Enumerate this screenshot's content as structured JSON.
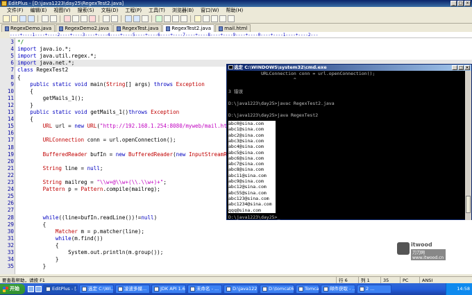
{
  "window": {
    "title": "EditPlus - [D:\\java1223\\day25\\RegexTest2.java]"
  },
  "menu": [
    "文件(F)",
    "编辑(E)",
    "视图(V)",
    "搜索(S)",
    "文档(D)",
    "工程(P)",
    "工具(T)",
    "浏览器(B)",
    "窗口(W)",
    "帮助(H)"
  ],
  "tabs": [
    {
      "label": "RegexDemo.java"
    },
    {
      "label": "RegexDemo2.java"
    },
    {
      "label": "RegexTest.java"
    },
    {
      "label": "RegexTest2.java"
    },
    {
      "label": "mail.html"
    }
  ],
  "ruler": "----+----1----+----2----+----3----+----4----+----5----+----6----+----7----+----8----+----9----+----0----+----1----+----2---",
  "editor": {
    "lines": [
      {
        "n": "3",
        "t": "*/",
        "cls": "cmt"
      },
      {
        "n": "4",
        "t": "import java.io.*;",
        "cls": "imp"
      },
      {
        "n": "5",
        "t": "import java.util.regex.*;",
        "cls": "imp"
      },
      {
        "n": "6",
        "t": "import java.net.*;",
        "cls": "imp"
      },
      {
        "n": "7",
        "t": "class RegexTest2",
        "cls": "cls"
      },
      {
        "n": "8",
        "t": "{",
        "cls": ""
      },
      {
        "n": "9",
        "t": "    public static void main(String[] args) throws Exception",
        "cls": "main"
      },
      {
        "n": "10",
        "t": "    {",
        "cls": ""
      },
      {
        "n": "11",
        "t": "        getMails_1();",
        "cls": ""
      },
      {
        "n": "12",
        "t": "    }",
        "cls": ""
      },
      {
        "n": "13",
        "t": "    public static void getMails_1()throws Exception",
        "cls": "m2"
      },
      {
        "n": "14",
        "t": "    {",
        "cls": ""
      },
      {
        "n": "15",
        "t": "        URL url = new URL(\"http://192.168.1.254:8080/myweb/mail.html\");",
        "cls": "url"
      },
      {
        "n": "16",
        "t": "",
        "cls": ""
      },
      {
        "n": "17",
        "t": "        URLConnection conn = url.openConnection();",
        "cls": "conn"
      },
      {
        "n": "18",
        "t": "",
        "cls": ""
      },
      {
        "n": "19",
        "t": "        BufferedReader bufIn = new BufferedReader(new InputStreamReader(conn.getInputStream()));",
        "cls": "buf"
      },
      {
        "n": "20",
        "t": "",
        "cls": ""
      },
      {
        "n": "21",
        "t": "        String line = null;",
        "cls": "str1"
      },
      {
        "n": "22",
        "t": "",
        "cls": ""
      },
      {
        "n": "23",
        "t": "        String mailreg = \"\\\\w+@\\\\w+(\\\\.\\\\w+)+\";",
        "cls": "reg"
      },
      {
        "n": "24",
        "t": "        Pattern p = Pattern.compile(mailreg);",
        "cls": "pat"
      },
      {
        "n": "25",
        "t": "",
        "cls": ""
      },
      {
        "n": "26",
        "t": "",
        "cls": ""
      },
      {
        "n": "27",
        "t": "",
        "cls": ""
      },
      {
        "n": "28",
        "t": "        while((line=bufIn.readLine())!=null)",
        "cls": "while"
      },
      {
        "n": "29",
        "t": "        {",
        "cls": ""
      },
      {
        "n": "30",
        "t": "            Matcher m = p.matcher(line);",
        "cls": "mat"
      },
      {
        "n": "31",
        "t": "            while(m.find())",
        "cls": "while"
      },
      {
        "n": "32",
        "t": "            {",
        "cls": ""
      },
      {
        "n": "33",
        "t": "                System.out.println(m.group());",
        "cls": ""
      },
      {
        "n": "34",
        "t": "            }",
        "cls": ""
      },
      {
        "n": "35",
        "t": "        }",
        "cls": ""
      }
    ]
  },
  "cmd": {
    "title": "选定 C:\\WINDOWS\\system32\\cmd.exe",
    "lines": [
      "            URLConnection conn = url.openConnection();",
      "                        ^",
      "",
      "3 错误",
      "",
      "D:\\java1223\\day25>javac RegexTest2.java",
      "",
      "D:\\java1223\\day25>java RegexTest2"
    ],
    "emails": [
      "abc0@sina.com",
      "abc1@sina.com",
      "abc2@sina.com",
      "abc3@sina.com",
      "abc4@sina.com",
      "abc5@sina.com",
      "abc6@sina.com",
      "abc7@sina.com",
      "abc8@sina.com",
      "abc11@sina.com",
      "abc9@sina.com",
      "abc12@sina.com",
      "abc55@sina.com",
      "abc123@sina.com",
      "abc1234@sina.com",
      "qqq@sina.com"
    ],
    "prompt": "D:\\java1223\\day25>_"
  },
  "logo": {
    "line1": "itwood",
    "line2": "刀刀网 www.itwood.cn"
  },
  "status": {
    "help": "要查看帮助，请按 F1",
    "row": "行 6",
    "col": "列 1",
    "len": "35",
    "eof": "PC",
    "enc": "ANSI"
  },
  "taskbar": {
    "start": "开始",
    "tasks": [
      "EditPlus - [...",
      "选定 C:\\WI...",
      "凌波多媒...",
      "JDK API 1.6...",
      "未命名 - ...",
      "D:\\java122...",
      "D:\\tomcat6...",
      "Tomcat",
      "邮件获取 - ...",
      "2 ..."
    ],
    "clock": "14:58"
  }
}
